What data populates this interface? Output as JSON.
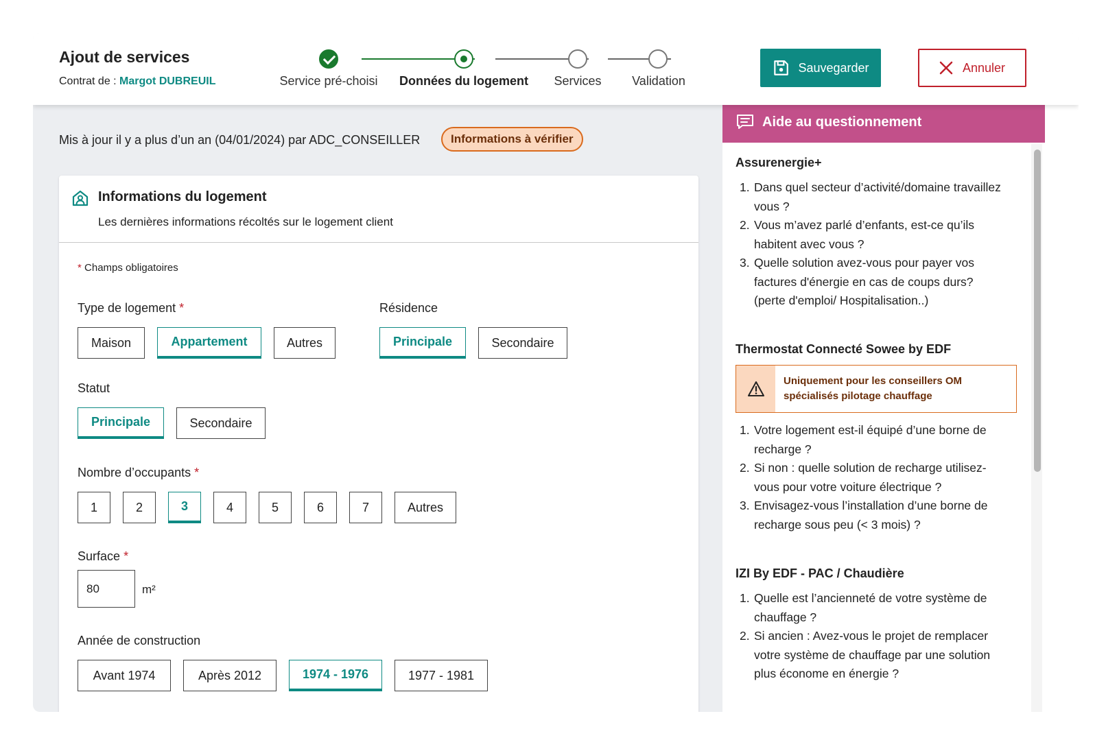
{
  "header": {
    "title": "Ajout de services",
    "contract_prefix": "Contrat de : ",
    "client_name": "Margot DUBREUIL",
    "steps": [
      {
        "label": "Service pré-choisi",
        "state": "done"
      },
      {
        "label": "Données du logement",
        "state": "current"
      },
      {
        "label": "Services",
        "state": "todo"
      },
      {
        "label": "Validation",
        "state": "todo"
      }
    ],
    "save_label": "Sauvegarder",
    "cancel_label": "Annuler"
  },
  "main": {
    "update_text": "Mis à jour il y a plus d’un an (04/01/2024) par ADC_CONSEILLER",
    "verify_badge": "Informations à vérifier",
    "card": {
      "title": "Informations du logement",
      "subtitle": "Les dernières informations récoltés sur le logement client",
      "required_note": "Champs obligatoires",
      "type_label": "Type de logement",
      "type_options": [
        "Maison",
        "Appartement",
        "Autres"
      ],
      "type_selected": "Appartement",
      "residence_label": "Résidence",
      "residence_options": [
        "Principale",
        "Secondaire"
      ],
      "residence_selected": "Principale",
      "statut_label": "Statut",
      "statut_options": [
        "Principale",
        "Secondaire"
      ],
      "statut_selected": "Principale",
      "occupants_label": "Nombre d’occupants",
      "occupants_options": [
        "1",
        "2",
        "3",
        "4",
        "5",
        "6",
        "7",
        "Autres"
      ],
      "occupants_selected": "3",
      "surface_label": "Surface",
      "surface_value": "80",
      "surface_unit": "m²",
      "annee_label": "Année de construction",
      "annee_options": [
        "Avant 1974",
        "Après 2012",
        "1974 - 1976",
        "1977 - 1981"
      ],
      "annee_selected": "1974 - 1976"
    }
  },
  "side": {
    "title": "Aide au questionnement",
    "sections": [
      {
        "title": "Assurenergie+",
        "questions": [
          [
            "Dans quel secteur d’activité/domaine travaillez",
            "vous ?"
          ],
          [
            "Vous m’avez parlé d’enfants, est-ce qu’ils",
            "habitent avec vous ?"
          ],
          [
            "Quelle solution avez-vous pour payer vos",
            "factures d'énergie en cas de coups durs?",
            "(perte d'emploi/ Hospitalisation..)"
          ]
        ]
      },
      {
        "title": "Thermostat Connecté Sowee by EDF",
        "warning": [
          "Uniquement pour les conseillers OM",
          "spécialisés pilotage chauffage"
        ],
        "questions": [
          [
            "Votre logement est-il équipé d’une borne de",
            "recharge ?"
          ],
          [
            "Si non : quelle solution de recharge utilisez-",
            "vous pour votre voiture électrique ?"
          ],
          [
            "Envisagez-vous l’installation d’une borne de",
            "recharge sous peu (< 3 mois) ?"
          ]
        ]
      },
      {
        "title": "IZI By EDF - PAC / Chaudière",
        "questions": [
          [
            "Quelle est l’ancienneté de votre système de",
            "chauffage ?"
          ],
          [
            "Si ancien : Avez-vous le projet de remplacer",
            "votre système de chauffage par une solution",
            "plus économe en énergie ?"
          ]
        ]
      }
    ]
  },
  "colors": {
    "accent": "#0e8a83",
    "danger": "#c0202b",
    "side_header": "#c2508a",
    "warning": "#d96a1d",
    "step_done": "#1a7a2e"
  }
}
